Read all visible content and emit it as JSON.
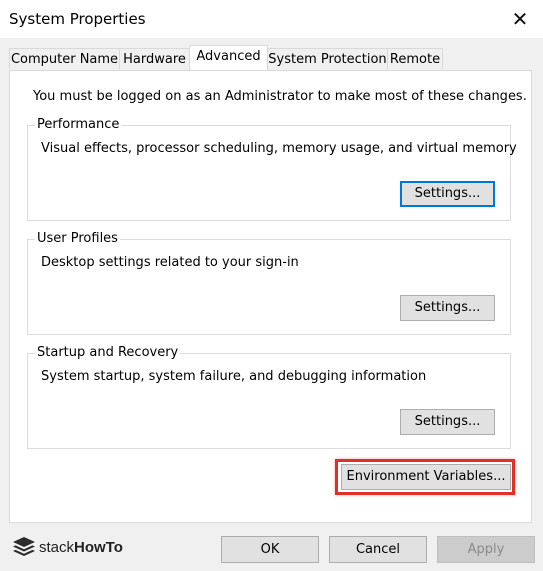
{
  "window": {
    "title": "System Properties",
    "close_icon": "close-icon"
  },
  "tabs": [
    {
      "label": "Computer Name",
      "active": false
    },
    {
      "label": "Hardware",
      "active": false
    },
    {
      "label": "Advanced",
      "active": true
    },
    {
      "label": "System Protection",
      "active": false
    },
    {
      "label": "Remote",
      "active": false
    }
  ],
  "advanced": {
    "admin_note": "You must be logged on as an Administrator to make most of these changes.",
    "performance": {
      "label": "Performance",
      "description": "Visual effects, processor scheduling, memory usage, and virtual memory",
      "button": "Settings..."
    },
    "user_profiles": {
      "label": "User Profiles",
      "description": "Desktop settings related to your sign-in",
      "button": "Settings..."
    },
    "startup_recovery": {
      "label": "Startup and Recovery",
      "description": "System startup, system failure, and debugging information",
      "button": "Settings..."
    },
    "environment_variables_button": "Environment Variables..."
  },
  "footer": {
    "ok": "OK",
    "cancel": "Cancel",
    "apply": "Apply"
  },
  "watermark": {
    "brand_regular": "stack",
    "brand_bold": "HowTo"
  },
  "colors": {
    "focus": "#0078d7",
    "highlight": "#e0302a"
  }
}
